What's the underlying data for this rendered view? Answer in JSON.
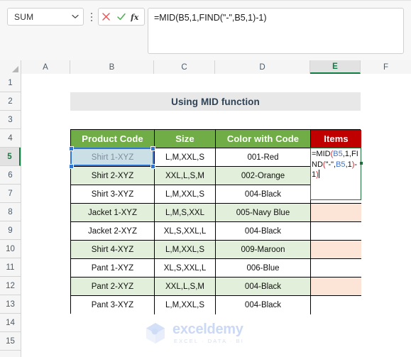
{
  "formula_bar": {
    "name_box_value": "SUM",
    "name_box_icon": "chevron-down-icon",
    "cancel_icon": "cancel-x-icon",
    "enter_icon": "enter-check-icon",
    "insert_function_icon": "fx-icon",
    "formula_text": "=MID(B5,1,FIND(\"-\",B5,1)-1)"
  },
  "grid": {
    "columns": [
      "A",
      "B",
      "C",
      "D",
      "E",
      "F"
    ],
    "active_column": "E",
    "rows": [
      "1",
      "2",
      "3",
      "4",
      "5",
      "6",
      "7",
      "8",
      "9",
      "10",
      "11",
      "12",
      "13",
      "14",
      "15"
    ],
    "active_row": "5"
  },
  "title_banner": {
    "text": "Using MID function"
  },
  "table": {
    "headers": [
      "Product Code",
      "Size",
      "Color with Code",
      "Items"
    ],
    "header_colors": [
      "#70AD47",
      "#70AD47",
      "#70AD47",
      "#C00000"
    ],
    "rows": [
      {
        "row": "5",
        "product_code": "Shirt 1-XYZ",
        "size": "L,M,XXL,S",
        "color_with_code": "001-Red",
        "items": ""
      },
      {
        "row": "6",
        "product_code": "Shirt 2-XYZ",
        "size": "XXL,L,S,M",
        "color_with_code": "002-Orange",
        "items": ""
      },
      {
        "row": "7",
        "product_code": "Shirt 3-XYZ",
        "size": "L,M,XXL,S",
        "color_with_code": "004-Black",
        "items": ""
      },
      {
        "row": "8",
        "product_code": "Jacket 1-XYZ",
        "size": "L,M,S,XXL",
        "color_with_code": "005-Navy Blue",
        "items": ""
      },
      {
        "row": "9",
        "product_code": "Jacket 2-XYZ",
        "size": "XL,S,XXL,L",
        "color_with_code": "004-Black",
        "items": ""
      },
      {
        "row": "10",
        "product_code": "Shirt 4-XYZ",
        "size": "L,M,XXL,S",
        "color_with_code": "009-Maroon",
        "items": ""
      },
      {
        "row": "11",
        "product_code": "Pant 1-XYZ",
        "size": "XL,S,XXL,L",
        "color_with_code": "006-Blue",
        "items": ""
      },
      {
        "row": "12",
        "product_code": "Pant 2-XYZ",
        "size": "XXL,L,S,M",
        "color_with_code": "004-Black",
        "items": ""
      },
      {
        "row": "13",
        "product_code": "Pant 3-XYZ",
        "size": "L,M,XXL,S",
        "color_with_code": "004-Black",
        "items": ""
      }
    ],
    "band_color": "#E2EFDA",
    "items_fill_color": "#FCE4D6"
  },
  "edit_cell": {
    "address": "E5",
    "tokens": [
      {
        "t": "=MID",
        "c": "black"
      },
      {
        "t": "(",
        "c": "paren"
      },
      {
        "t": "B5",
        "c": "ref"
      },
      {
        "t": ",1,",
        "c": "black"
      },
      {
        "t": "FIND",
        "c": "black"
      },
      {
        "t": "(",
        "c": "paren"
      },
      {
        "t": "\"-\",",
        "c": "black"
      },
      {
        "t": "B5",
        "c": "ref"
      },
      {
        "t": ",1",
        "c": "black"
      },
      {
        "t": ")",
        "c": "paren"
      },
      {
        "t": "-1",
        "c": "black"
      },
      {
        "t": ")",
        "c": "paren"
      }
    ],
    "ref_color": "#4472C4",
    "paren_color": "#D1282E"
  },
  "selection": {
    "reference_cell": "B5",
    "reference_border_color": "#2E75D4"
  },
  "watermark": {
    "name": "exceldemy",
    "tagline": "EXCEL · DATA · BI"
  }
}
